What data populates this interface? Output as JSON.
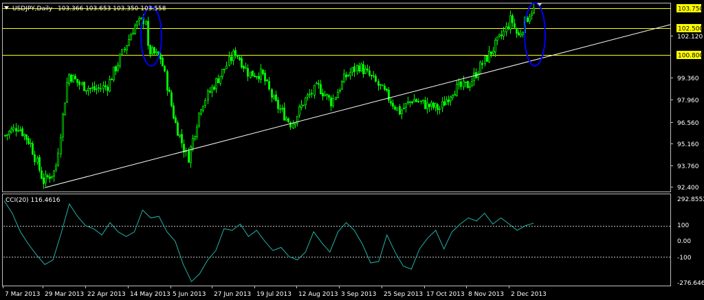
{
  "main_chart": {
    "symbol_header": "USDJPY,Daily",
    "ohlc_header": "103.366 103.653 103.350 103.558",
    "price_ticks": [
      "102.120",
      "99.360",
      "97.960",
      "96.560",
      "95.160",
      "93.760",
      "92.400"
    ],
    "horizontal_levels": [
      {
        "value": 103.75,
        "label": "103.750",
        "color": "#ffff00"
      },
      {
        "value": 102.5,
        "label": "102.500",
        "color": "#ffff00"
      },
      {
        "value": 100.8,
        "label": "100.800",
        "color": "#ffff00"
      }
    ],
    "candle_color": "#00ff00",
    "trendline_color": "#ffffff",
    "ellipse_color": "#0000ff"
  },
  "cci_panel": {
    "title": "CCI(20) 116.4616",
    "ticks": [
      "292.8552",
      "100",
      "0.00",
      "-100",
      "-276.6462"
    ],
    "line_color": "#20b2aa"
  },
  "date_ticks": [
    "7 Mar 2013",
    "29 Mar 2013",
    "22 Apr 2013",
    "14 May 2013",
    "5 Jun 2013",
    "27 Jun 2013",
    "19 Jul 2013",
    "12 Aug 2013",
    "3 Sep 2013",
    "25 Sep 2013",
    "17 Oct 2013",
    "8 Nov 2013",
    "2 Dec 2013"
  ],
  "chart_data": [
    {
      "type": "candlestick",
      "title": "USDJPY,Daily",
      "x_label_ticks": [
        "7 Mar 2013",
        "29 Mar 2013",
        "22 Apr 2013",
        "14 May 2013",
        "5 Jun 2013",
        "27 Jun 2013",
        "19 Jul 2013",
        "12 Aug 2013",
        "3 Sep 2013",
        "25 Sep 2013",
        "17 Oct 2013",
        "8 Nov 2013",
        "2 Dec 2013"
      ],
      "ylim": [
        92.2,
        104.0
      ],
      "y_ticks": [
        92.4,
        93.76,
        95.16,
        96.56,
        97.96,
        99.36,
        102.12
      ],
      "close_path": [
        [
          "7 Mar 2013",
          95.7
        ],
        [
          "14 Mar 2013",
          96.3
        ],
        [
          "21 Mar 2013",
          95.2
        ],
        [
          "28 Mar 2013",
          92.8
        ],
        [
          "4 Apr 2013",
          93.5
        ],
        [
          "11 Apr 2013",
          99.6
        ],
        [
          "18 Apr 2013",
          98.9
        ],
        [
          "25 Apr 2013",
          98.6
        ],
        [
          "2 May 2013",
          98.8
        ],
        [
          "9 May 2013",
          100.6
        ],
        [
          "16 May 2013",
          102.6
        ],
        [
          "22 May 2013",
          103.1
        ],
        [
          "23 May 2013",
          101.1
        ],
        [
          "30 May 2013",
          100.6
        ],
        [
          "6 Jun 2013",
          96.6
        ],
        [
          "13 Jun 2013",
          94.2
        ],
        [
          "20 Jun 2013",
          97.6
        ],
        [
          "27 Jun 2013",
          98.9
        ],
        [
          "8 Jul 2013",
          101.0
        ],
        [
          "15 Jul 2013",
          99.6
        ],
        [
          "22 Jul 2013",
          99.6
        ],
        [
          "29 Jul 2013",
          97.8
        ],
        [
          "8 Aug 2013",
          96.4
        ],
        [
          "15 Aug 2013",
          97.9
        ],
        [
          "22 Aug 2013",
          98.8
        ],
        [
          "29 Aug 2013",
          97.8
        ],
        [
          "5 Sep 2013",
          99.4
        ],
        [
          "12 Sep 2013",
          100.1
        ],
        [
          "19 Sep 2013",
          99.3
        ],
        [
          "26 Sep 2013",
          98.3
        ],
        [
          "3 Oct 2013",
          97.2
        ],
        [
          "10 Oct 2013",
          98.0
        ],
        [
          "17 Oct 2013",
          97.6
        ],
        [
          "24 Oct 2013",
          97.4
        ],
        [
          "31 Oct 2013",
          98.6
        ],
        [
          "8 Nov 2013",
          98.9
        ],
        [
          "15 Nov 2013",
          100.1
        ],
        [
          "22 Nov 2013",
          101.2
        ],
        [
          "29 Nov 2013",
          102.4
        ],
        [
          "2 Dec 2013",
          103.1
        ],
        [
          "6 Dec 2013",
          101.9
        ],
        [
          "13 Dec 2013",
          103.6
        ]
      ],
      "horizontal_levels": [
        103.75,
        102.5,
        100.8
      ],
      "trendline": [
        [
          "29 Mar 2013",
          92.4
        ],
        [
          "13 Dec 2013",
          100.4
        ]
      ],
      "annotations": [
        "ellipse around May 2013 highs",
        "ellipse around December 2013 highs"
      ]
    },
    {
      "type": "line",
      "title": "CCI(20) 116.4616",
      "ylim": [
        -276.6462,
        292.8552
      ],
      "y_ticks": [
        -100,
        0,
        100
      ],
      "reference_lines": [
        100,
        -100
      ],
      "series": [
        {
          "name": "CCI(20)",
          "values": [
            260,
            180,
            60,
            -20,
            -90,
            -150,
            -120,
            50,
            240,
            160,
            100,
            80,
            40,
            120,
            60,
            30,
            60,
            200,
            150,
            160,
            60,
            0,
            -150,
            -260,
            -210,
            -120,
            -60,
            80,
            70,
            110,
            30,
            70,
            0,
            -60,
            -40,
            -100,
            -120,
            -70,
            60,
            -10,
            -70,
            60,
            120,
            70,
            -20,
            -140,
            -130,
            40,
            -70,
            -160,
            -180,
            -50,
            20,
            70,
            -50,
            60,
            110,
            150,
            130,
            180,
            110,
            150,
            110,
            70,
            100,
            116
          ]
        }
      ]
    }
  ]
}
